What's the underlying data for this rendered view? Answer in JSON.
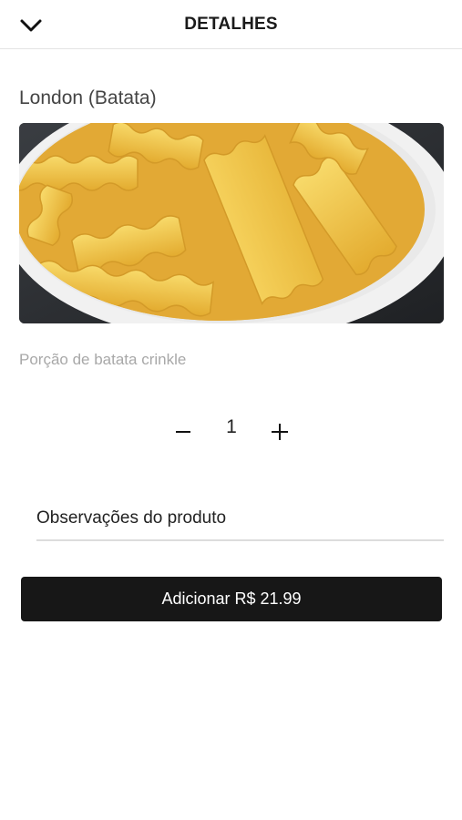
{
  "header": {
    "title": "DETALHES",
    "back_icon": "chevron-down-icon"
  },
  "product": {
    "name": "London (Batata)",
    "description": "Porção de batata crinkle",
    "image_icon": "crinkle-fries-photo"
  },
  "quantity": {
    "value": "1",
    "minus_icon": "minus-icon",
    "plus_icon": "plus-icon"
  },
  "notes": {
    "placeholder": "Observações do produto"
  },
  "add_button": {
    "label": "Adicionar R$ 21.99"
  },
  "colors": {
    "button_bg": "#171717",
    "accent_fries": "#f2c84b"
  }
}
